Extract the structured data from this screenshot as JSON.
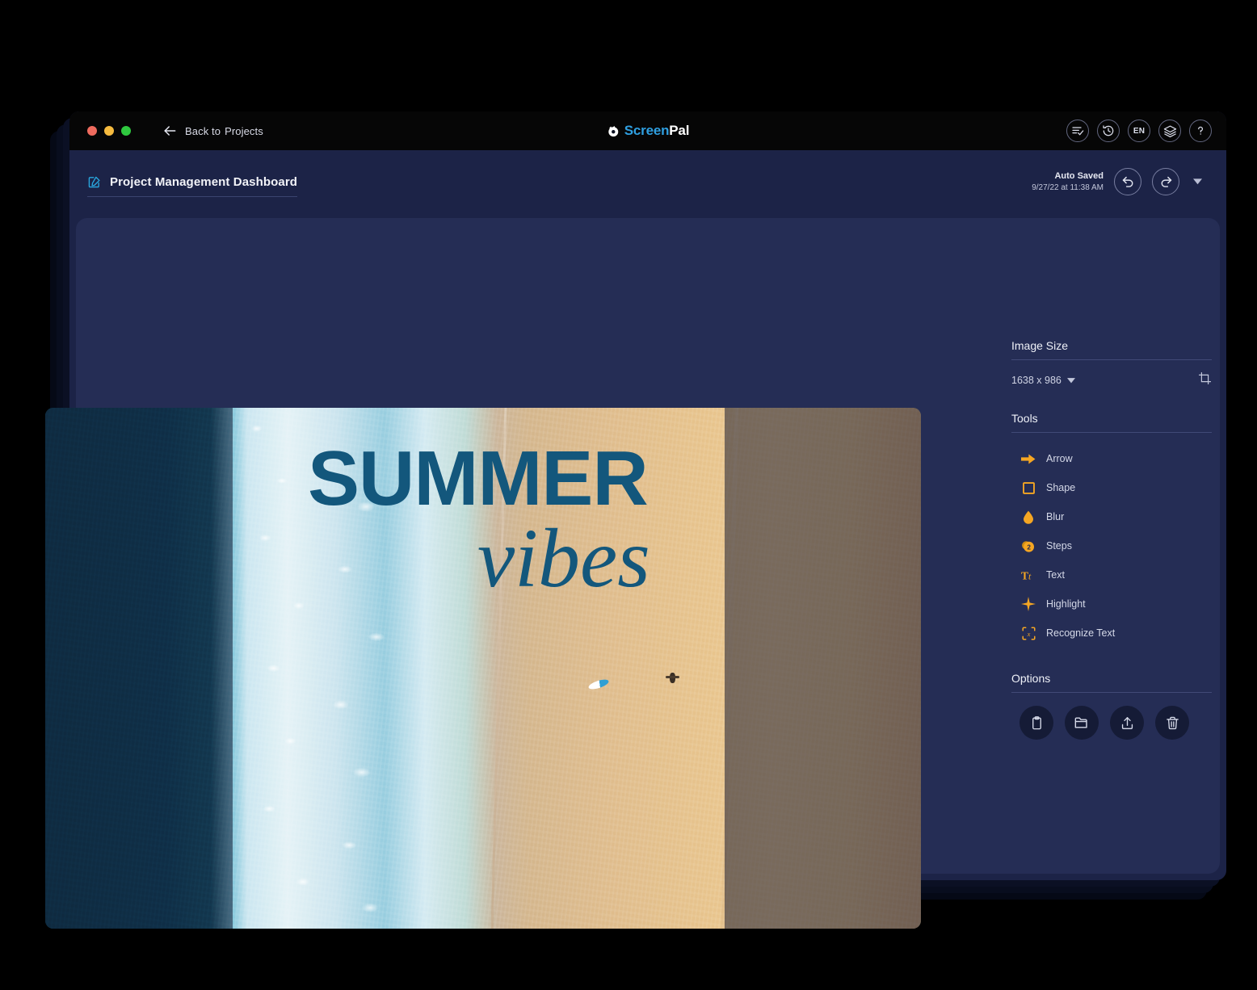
{
  "window": {
    "traffic_lights": [
      "close",
      "minimize",
      "maximize"
    ],
    "back_label_1": "Back to",
    "back_label_2": "Projects",
    "brand_1": "Screen",
    "brand_2": "Pal",
    "topbar_buttons": [
      {
        "name": "list-check-icon",
        "label": ""
      },
      {
        "name": "history-clock-icon",
        "label": ""
      },
      {
        "name": "language-icon",
        "label": "EN"
      },
      {
        "name": "layers-icon",
        "label": ""
      },
      {
        "name": "help-icon",
        "label": "?"
      }
    ]
  },
  "header": {
    "project_title": "Project Management Dashboard",
    "autosave_status": "Auto Saved",
    "autosave_time": "9/27/22 at 11:38 AM",
    "undo_label": "Undo",
    "redo_label": "Redo"
  },
  "sidebar": {
    "image_size": {
      "heading": "Image Size",
      "value": "1638 x 986"
    },
    "tools": {
      "heading": "Tools",
      "items": [
        {
          "label": "Arrow",
          "icon": "arrow-icon"
        },
        {
          "label": "Shape",
          "icon": "shape-square-icon"
        },
        {
          "label": "Blur",
          "icon": "blur-droplet-icon"
        },
        {
          "label": "Steps",
          "icon": "steps-number-icon",
          "badge": "2"
        },
        {
          "label": "Text",
          "icon": "text-tt-icon",
          "glyph": "Tt"
        },
        {
          "label": "Highlight",
          "icon": "highlight-sparkle-icon"
        },
        {
          "label": "Recognize Text",
          "icon": "recognize-text-icon"
        }
      ]
    },
    "options": {
      "heading": "Options",
      "items": [
        {
          "label": "Copy to clipboard",
          "icon": "clipboard-icon"
        },
        {
          "label": "Open folder",
          "icon": "folder-icon"
        },
        {
          "label": "Upload",
          "icon": "upload-icon"
        },
        {
          "label": "Delete",
          "icon": "trash-icon"
        }
      ]
    }
  },
  "canvas": {
    "headline_primary": "SUMMER",
    "headline_secondary": "vibes",
    "headline_color": "#13577c"
  },
  "colors": {
    "accent_yellow": "#f5a623",
    "accent_blue": "#2f9fe0",
    "panel_bg": "#252d55",
    "window_bg": "#1c2347",
    "titlebar_bg": "#060606"
  }
}
